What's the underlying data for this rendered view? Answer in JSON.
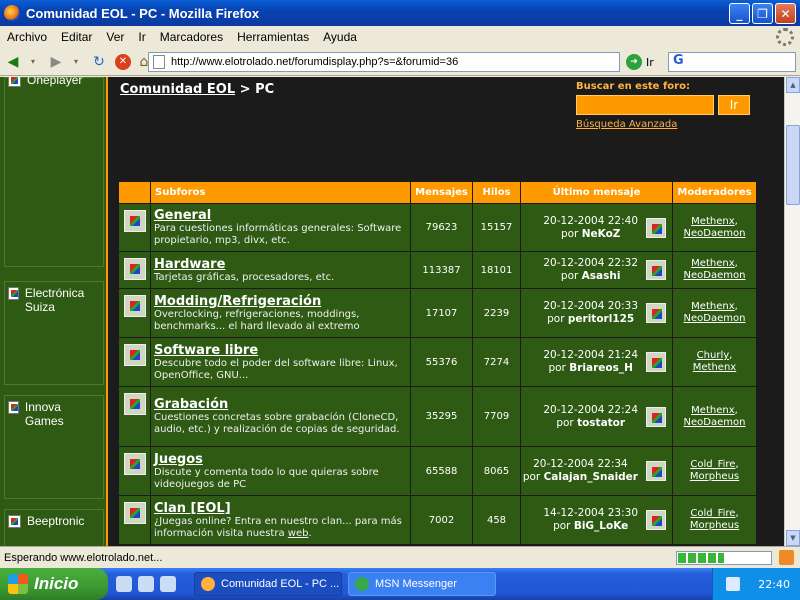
{
  "window": {
    "title": "Comunidad EOL - PC - Mozilla Firefox"
  },
  "menu": [
    "Archivo",
    "Editar",
    "Ver",
    "Ir",
    "Marcadores",
    "Herramientas",
    "Ayuda"
  ],
  "nav": {
    "url": "http://www.elotrolado.net/forumdisplay.php?s=&forumid=36",
    "go_label": "Ir",
    "search_engine": "G"
  },
  "sidebar": {
    "items": [
      {
        "label": "Oneplayer"
      },
      {
        "label": "Electrónica Suiza"
      },
      {
        "label": "Innova Games"
      },
      {
        "label": "Beeptronic"
      }
    ]
  },
  "breadcrumb": {
    "root": "Comunidad EOL",
    "sep": " > ",
    "current": "PC"
  },
  "forum_search": {
    "label": "Buscar en este foro:",
    "button": "Ir",
    "advanced": "Búsqueda Avanzada"
  },
  "table": {
    "headers": [
      "Subforos",
      "Mensajes",
      "Hilos",
      "Último mensaje",
      "Moderadores"
    ],
    "rows": [
      {
        "name": "General",
        "desc": "Para cuestiones informáticas generales: Software propietario, mp3, divx, etc.",
        "msgs": "79623",
        "threads": "15157",
        "date": "20-12-2004 22:40",
        "by": "por ",
        "user": "NeKoZ",
        "mods": [
          "Methenx",
          "NeoDaemon"
        ]
      },
      {
        "name": "Hardware",
        "desc": "Tarjetas gráficas, procesadores, etc.",
        "msgs": "113387",
        "threads": "18101",
        "date": "20-12-2004 22:32",
        "by": "por ",
        "user": "Asashi",
        "mods": [
          "Methenx",
          "NeoDaemon"
        ]
      },
      {
        "name": "Modding/Refrigeración",
        "desc": "Overclocking, refrigeraciones, moddings, benchmarks... el hard llevado al extremo",
        "msgs": "17107",
        "threads": "2239",
        "date": "20-12-2004 20:33",
        "by": "por ",
        "user": "peritorl125",
        "mods": [
          "Methenx",
          "NeoDaemon"
        ]
      },
      {
        "name": "Software libre",
        "desc": "Descubre todo el poder del software libre: Linux, OpenOffice, GNU...",
        "msgs": "55376",
        "threads": "7274",
        "date": "20-12-2004 21:24",
        "by": "por ",
        "user": "Briareos_H",
        "mods": [
          "Churly",
          "Methenx"
        ]
      },
      {
        "name": "Grabación",
        "desc": "Cuestiones concretas sobre grabación (CloneCD, audio, etc.) y realización de copias de seguridad.",
        "msgs": "35295",
        "threads": "7709",
        "date": "20-12-2004 22:24",
        "by": "por ",
        "user": "tostator",
        "mods": [
          "Methenx",
          "NeoDaemon"
        ]
      },
      {
        "name": "Juegos",
        "desc": "Discute y comenta todo lo que quieras sobre videojuegos de PC",
        "msgs": "65588",
        "threads": "8065",
        "date": "20-12-2004 22:34",
        "by": "por ",
        "user": "Calajan_Snaider",
        "mods": [
          "Cold_Fire",
          "Morpheus"
        ]
      },
      {
        "name": "Clan [EOL]",
        "desc": "¿Juegas online? Entra en nuestro clan... para más información visita nuestra ",
        "desc_link": "web",
        "desc_end": ".",
        "msgs": "7002",
        "threads": "458",
        "date": "14-12-2004 23:30",
        "by": "por ",
        "user": "BiG_LoKe",
        "mods": [
          "Cold_Fire",
          "Morpheus"
        ]
      }
    ]
  },
  "status": {
    "text": "Esperando www.elotrolado.net...",
    "progress": 0.5
  },
  "taskbar": {
    "start": "Inicio",
    "tasks": [
      "Comunidad EOL - PC ...",
      "MSN Messenger"
    ],
    "clock": "22:40"
  }
}
